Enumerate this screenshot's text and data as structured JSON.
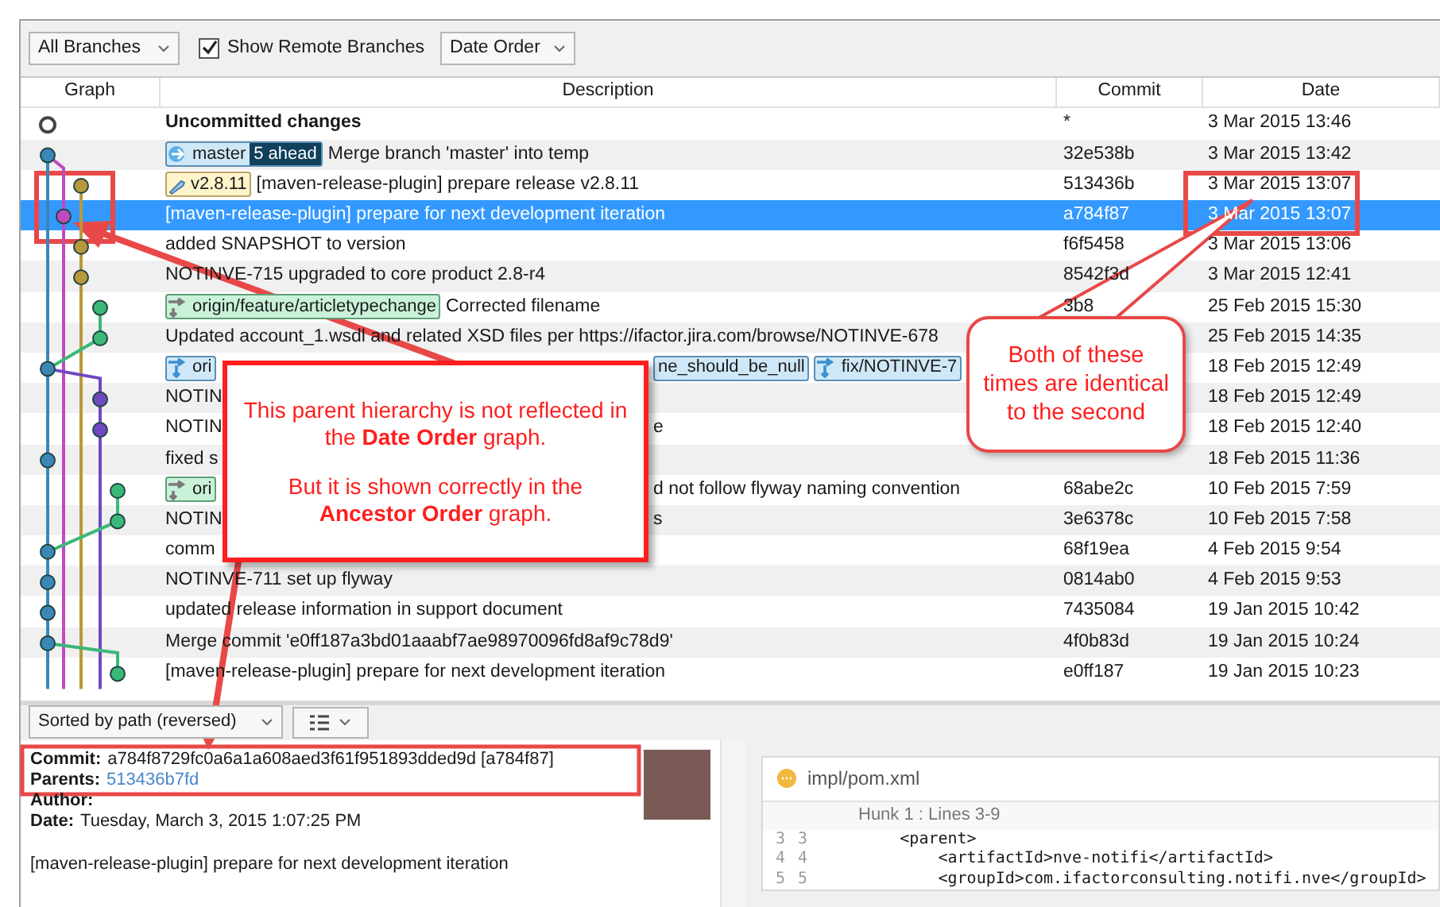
{
  "toolbar": {
    "branch_filter": "All Branches",
    "show_remote": {
      "label": "Show Remote Branches",
      "checked": true
    },
    "order": "Date Order"
  },
  "columns": [
    "Graph",
    "Description",
    "Commit",
    "Date"
  ],
  "rows": [
    {
      "kind": "uncommitted",
      "selected": false,
      "description": "Uncommitted changes",
      "commit": "*",
      "date": "3 Mar 2015 13:46"
    },
    {
      "kind": "commit",
      "selected": false,
      "refs": [
        {
          "kind": "branch",
          "label": "master",
          "ahead": "5 ahead"
        }
      ],
      "description": "Merge branch 'master' into temp",
      "commit": "32e538b",
      "date": "3 Mar 2015 13:42"
    },
    {
      "kind": "commit",
      "selected": false,
      "refs": [
        {
          "kind": "tag",
          "label": "v2.8.11"
        }
      ],
      "description": "[maven-release-plugin] prepare release v2.8.11",
      "commit": "513436b",
      "date": "3 Mar 2015 13:07"
    },
    {
      "kind": "commit",
      "selected": true,
      "description": "[maven-release-plugin] prepare for next development iteration",
      "commit": "a784f87",
      "date": "3 Mar 2015 13:07"
    },
    {
      "kind": "commit",
      "selected": false,
      "description": "added SNAPSHOT to version",
      "commit": "f6f5458",
      "date": "3 Mar 2015 13:06"
    },
    {
      "kind": "commit",
      "selected": false,
      "description": "NOTINVE-715 upgraded to core product 2.8-r4",
      "commit": "8542f3d",
      "date": "3 Mar 2015 12:41"
    },
    {
      "kind": "commit",
      "selected": false,
      "refs": [
        {
          "kind": "remote",
          "label": "origin/feature/articletypechange"
        }
      ],
      "description": "Corrected filename",
      "commit": "3b8",
      "date": "25 Feb 2015 15:30"
    },
    {
      "kind": "commit",
      "selected": false,
      "description": "Updated account_1.wsdl and related XSD files per https://ifactor.jira.com/browse/NOTINVE-678",
      "date": "25 Feb 2015 14:35"
    },
    {
      "kind": "commit",
      "selected": false,
      "refs": [
        {
          "kind": "remote-blue",
          "label": "ori"
        }
      ],
      "refs_right": [
        {
          "kind": "plain-blue",
          "label": "ne_should_be_null"
        },
        {
          "kind": "remote-blue",
          "label": "fix/NOTINVE-7"
        }
      ],
      "date": "18 Feb 2015 12:49"
    },
    {
      "kind": "commit",
      "selected": false,
      "description": "NOTIN",
      "date": "18 Feb 2015 12:49"
    },
    {
      "kind": "commit",
      "selected": false,
      "description": "NOTIN",
      "description_right": "e",
      "date": "18 Feb 2015 12:40"
    },
    {
      "kind": "commit",
      "selected": false,
      "description": "fixed s",
      "date": "18 Feb 2015 11:36"
    },
    {
      "kind": "commit",
      "selected": false,
      "refs": [
        {
          "kind": "remote",
          "label": "ori"
        }
      ],
      "description_right": "d not follow flyway naming convention",
      "commit": "68abe2c",
      "date": "10 Feb 2015 7:59"
    },
    {
      "kind": "commit",
      "selected": false,
      "description": "NOTIN",
      "description_right": "s",
      "commit": "3e6378c",
      "date": "10 Feb 2015 7:58"
    },
    {
      "kind": "commit",
      "selected": false,
      "description": "comm",
      "commit": "68f19ea",
      "date": "4 Feb 2015 9:54"
    },
    {
      "kind": "commit",
      "selected": false,
      "description": "NOTINVE-711 set up flyway",
      "commit": "0814ab0",
      "date": "4 Feb 2015 9:53"
    },
    {
      "kind": "commit",
      "selected": false,
      "description": "updated release information in support document",
      "commit": "7435084",
      "date": "19 Jan 2015 10:42"
    },
    {
      "kind": "commit",
      "selected": false,
      "description": "Merge commit 'e0ff187a3bd01aaabf7ae98970096fd8af9c78d9'",
      "commit": "4f0b83d",
      "date": "19 Jan 2015 10:24"
    },
    {
      "kind": "commit",
      "selected": false,
      "description": "[maven-release-plugin] prepare for next development iteration",
      "commit": "e0ff187",
      "date": "19 Jan 2015 10:23"
    }
  ],
  "details": {
    "sort": "Sorted by path (reversed)",
    "fields": [
      {
        "kind": "text",
        "label": "Commit:",
        "value": "a784f8729fc0a6a1a608aed3f61f951893dded9d [a784f87]"
      },
      {
        "kind": "link",
        "label": "Parents:",
        "value": "513436b7fd"
      },
      {
        "kind": "text",
        "label": "Author:"
      },
      {
        "kind": "text",
        "label": "Date:",
        "value": "Tuesday, March 3, 2015 1:07:25 PM"
      }
    ],
    "message": "[maven-release-plugin] prepare for next development iteration"
  },
  "diff": {
    "file": "impl/pom.xml",
    "hunk": "Hunk 1 : Lines 3-9",
    "lines": [
      {
        "old": "3",
        "new": "3",
        "code": "        <parent>"
      },
      {
        "old": "4",
        "new": "4",
        "code": "            <artifactId>nve-notifi</artifactId>"
      },
      {
        "old": "5",
        "new": "5",
        "code": "            <groupId>com.ifactorconsulting.notifi.nve</groupId>"
      }
    ]
  },
  "annotations": {
    "callout": [
      "This parent hierarchy is not reflected in the **Date Order** graph.",
      "But it is shown correctly in the **Ancestor Order** graph."
    ],
    "bubble": "Both of these times are identical to the second"
  }
}
